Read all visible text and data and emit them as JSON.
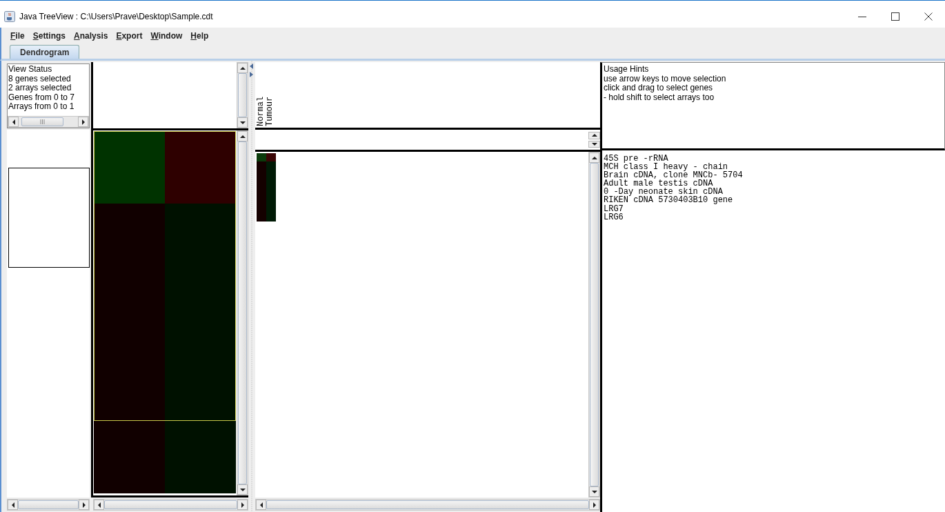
{
  "window": {
    "title": "Java TreeView : C:\\Users\\Prave\\Desktop\\Sample.cdt"
  },
  "menu": [
    {
      "label": "File"
    },
    {
      "label": "Settings"
    },
    {
      "label": "Analysis"
    },
    {
      "label": "Export"
    },
    {
      "label": "Window"
    },
    {
      "label": "Help"
    }
  ],
  "tabs": [
    {
      "label": "Dendrogram",
      "selected": true
    }
  ],
  "view_status": {
    "lines": [
      "View Status",
      "8 genes selected",
      "2 arrays selected",
      "Genes from 0 to 7",
      "Arrays from 0 to 1"
    ]
  },
  "array_labels": [
    "Normal",
    "Tumour"
  ],
  "usage_hints": {
    "lines": [
      "Usage Hints",
      "use arrow keys to move selection",
      "click and drag to select genes",
      "- hold shift to select arrays too"
    ]
  },
  "gene_names": [
    "45S pre -rRNA",
    "MCH class I heavy - chain",
    "Brain cDNA, clone MNCb- 5704",
    "Adult male testis cDNA",
    "0 -Day neonate skin cDNA",
    "RIKEN cDNA 5730403B10 gene",
    "LRG7",
    "LRG6"
  ],
  "zoom_heatmap": {
    "rows": [
      {
        "selected": true,
        "cells": [
          {
            "color": "#003300"
          },
          {
            "color": "#2e0000"
          }
        ]
      },
      {
        "selected": true,
        "cells": [
          {
            "color": "#110000"
          },
          {
            "color": "#001100"
          }
        ]
      },
      {
        "selected": true,
        "cells": [
          {
            "color": "#110000"
          },
          {
            "color": "#001100"
          }
        ]
      },
      {
        "selected": true,
        "cells": [
          {
            "color": "#110000"
          },
          {
            "color": "#001100"
          }
        ]
      },
      {
        "selected": false,
        "cells": [
          {
            "color": "#110000"
          },
          {
            "color": "#001100"
          }
        ]
      }
    ]
  },
  "global_heatmap": {
    "rows": [
      {
        "cells": [
          {
            "color": "#0a3a0a"
          },
          {
            "color": "#3a0505"
          }
        ]
      },
      {
        "cells": [
          {
            "color": "#140000"
          },
          {
            "color": "#001a05"
          }
        ]
      },
      {
        "cells": [
          {
            "color": "#140000"
          },
          {
            "color": "#001a05"
          }
        ]
      },
      {
        "cells": [
          {
            "color": "#140000"
          },
          {
            "color": "#001a05"
          }
        ]
      },
      {
        "cells": [
          {
            "color": "#140000"
          },
          {
            "color": "#001a05"
          }
        ]
      },
      {
        "cells": [
          {
            "color": "#140000"
          },
          {
            "color": "#001a05"
          }
        ]
      },
      {
        "cells": [
          {
            "color": "#140000"
          },
          {
            "color": "#001a05"
          }
        ]
      },
      {
        "cells": [
          {
            "color": "#140000"
          },
          {
            "color": "#001a05"
          }
        ]
      }
    ]
  }
}
